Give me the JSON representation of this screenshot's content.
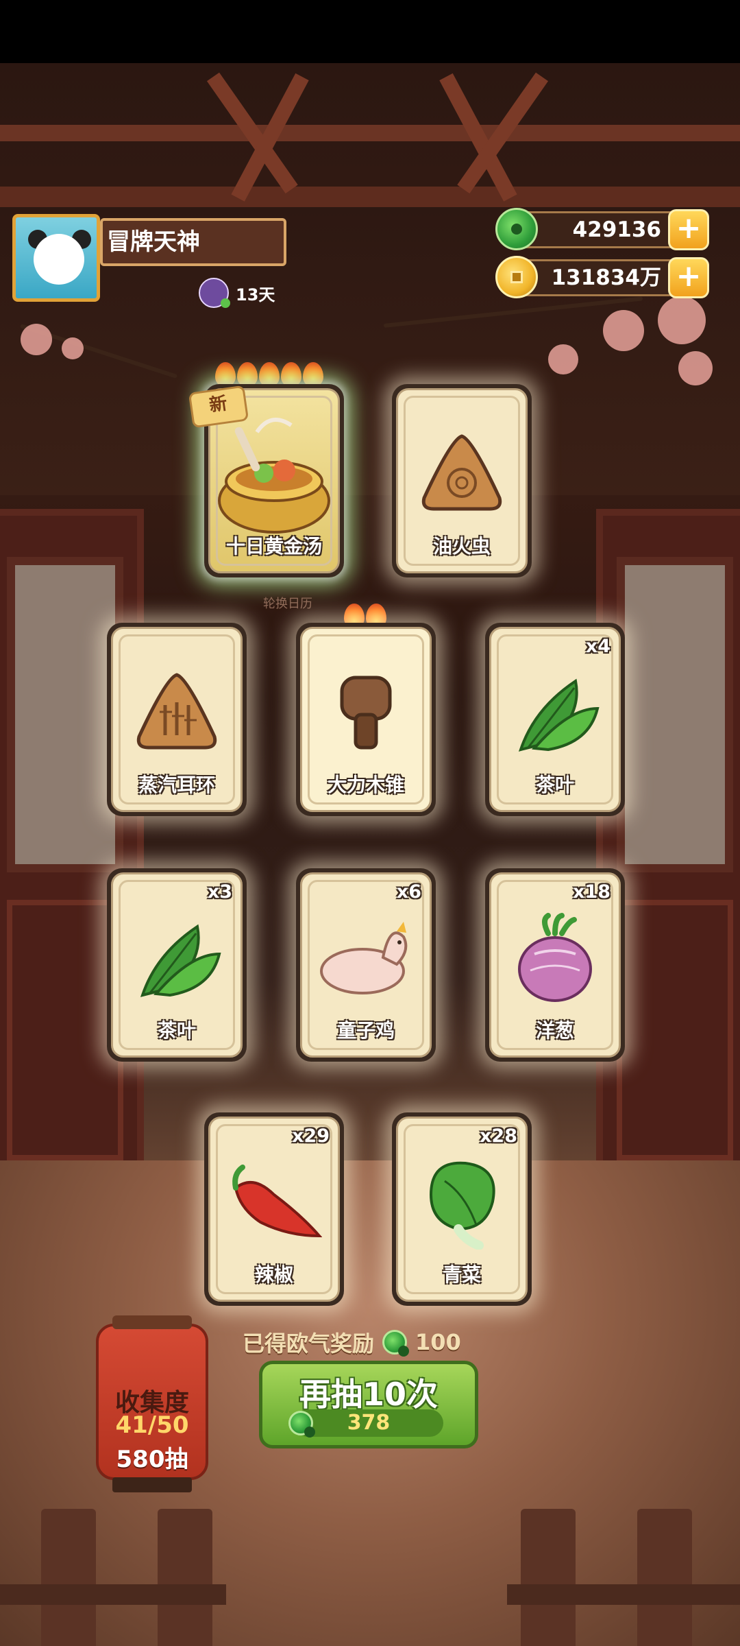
{
  "player": {
    "name": "冒牌天神",
    "days": "13天"
  },
  "currency": {
    "jade": "429136",
    "coins": "131834万"
  },
  "featured": {
    "new_tag": "新",
    "rotate_hint": "轮换日历"
  },
  "cards": [
    {
      "label": "十日黄金汤",
      "count": "",
      "icon": "golden-soup-icon"
    },
    {
      "label": "油火虫",
      "count": "",
      "icon": "rice-cake-icon"
    },
    {
      "label": "蒸汽耳环",
      "count": "",
      "icon": "steam-earring-icon"
    },
    {
      "label": "大力木锥",
      "count": "",
      "icon": "wooden-mallet-icon"
    },
    {
      "label": "茶叶",
      "count": "x4",
      "icon": "tea-leaf-icon"
    },
    {
      "label": "茶叶",
      "count": "x3",
      "icon": "tea-leaf-icon"
    },
    {
      "label": "童子鸡",
      "count": "x6",
      "icon": "chicken-icon"
    },
    {
      "label": "洋葱",
      "count": "x18",
      "icon": "onion-icon"
    },
    {
      "label": "辣椒",
      "count": "x29",
      "icon": "chili-icon"
    },
    {
      "label": "青菜",
      "count": "x28",
      "icon": "bok-choy-icon"
    }
  ],
  "reward": {
    "label": "已得欧气奖励",
    "value": "100"
  },
  "collection": {
    "title": "收集度",
    "progress": "41/50",
    "draws": "580抽"
  },
  "draw_button": {
    "label": "再抽10次",
    "cost": "378"
  },
  "colors": {
    "accent_green": "#5ea52a",
    "gold": "#f1b52a",
    "lantern_red": "#c7402a"
  }
}
